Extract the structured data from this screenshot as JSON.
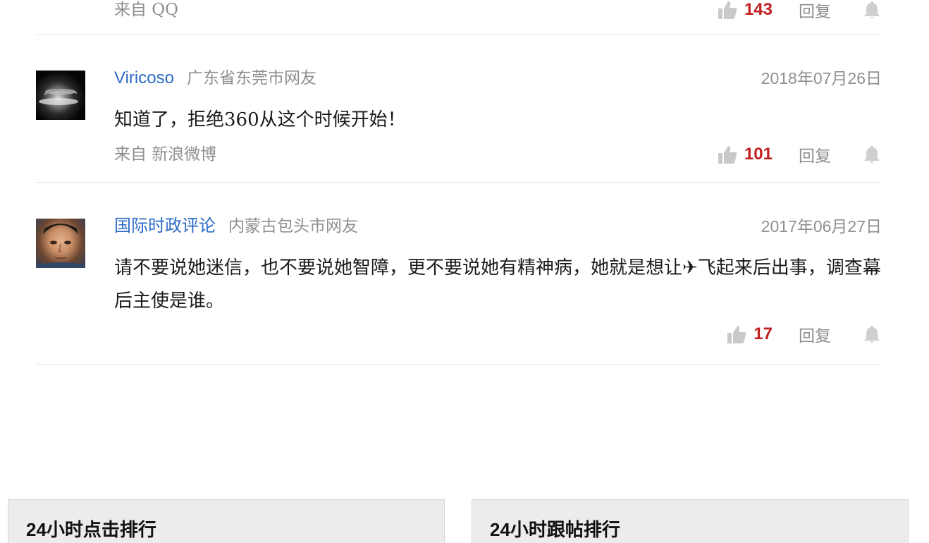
{
  "comments": [
    {
      "source": "来自 QQ",
      "likes": "143",
      "reply_label": "回复"
    },
    {
      "username": "Viricoso",
      "location": "广东省东莞市网友",
      "date": "2018年07月26日",
      "text": "知道了，拒绝360从这个时候开始！",
      "source": "来自 新浪微博",
      "likes": "101",
      "reply_label": "回复"
    },
    {
      "username": "国际时政评论",
      "location": "内蒙古包头市网友",
      "date": "2017年06月27日",
      "text": "请不要说她迷信，也不要说她智障，更不要说她有精神病，她就是想让✈飞起来后出事，调查幕后主使是谁。",
      "likes": "17",
      "reply_label": "回复"
    }
  ],
  "icons": {
    "like": "thumbs-up-icon",
    "notify": "bell-icon"
  },
  "colors": {
    "username": "#2d6bc8",
    "likes": "#c21f1f",
    "muted": "#8f8f8f",
    "panel_bg": "#ececec"
  },
  "rankings": {
    "clicks_title": "24小时点击排行",
    "comments_title": "24小时跟帖排行"
  }
}
